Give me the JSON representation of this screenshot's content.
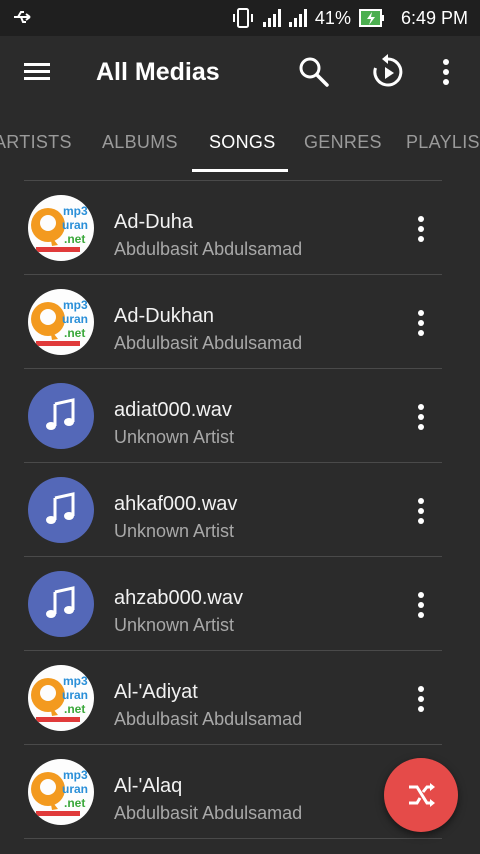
{
  "status_bar": {
    "battery": "41%",
    "time": "6:49 PM"
  },
  "app_bar": {
    "title": "All Medias"
  },
  "tabs": [
    {
      "label": "ARTISTS"
    },
    {
      "label": "ALBUMS"
    },
    {
      "label": "SONGS",
      "active": true
    },
    {
      "label": "GENRES"
    },
    {
      "label": "PLAYLISTS"
    }
  ],
  "songs": [
    {
      "title": "Ad-Duha",
      "artist": "Abdulbasit Abdulsamad",
      "art": "mp3quran-logo"
    },
    {
      "title": "Ad-Dukhan",
      "artist": "Abdulbasit Abdulsamad",
      "art": "mp3quran-logo"
    },
    {
      "title": "adiat000.wav",
      "artist": "Unknown Artist",
      "art": "music-note"
    },
    {
      "title": "ahkaf000.wav",
      "artist": "Unknown Artist",
      "art": "music-note"
    },
    {
      "title": "ahzab000.wav",
      "artist": "Unknown Artist",
      "art": "music-note"
    },
    {
      "title": "Al-'Adiyat",
      "artist": "Abdulbasit Abdulsamad",
      "art": "mp3quran-logo"
    },
    {
      "title": "Al-'Alaq",
      "artist": "Abdulbasit Abdulsamad",
      "art": "mp3quran-logo"
    }
  ],
  "logo_text": {
    "line1": "mp3",
    "line2": "uran",
    "line3": ".net"
  },
  "colors": {
    "background": "#2b2b2b",
    "fab": "#e54b49",
    "note_avatar": "#5468b8",
    "accent_tab": "#ffffff"
  }
}
